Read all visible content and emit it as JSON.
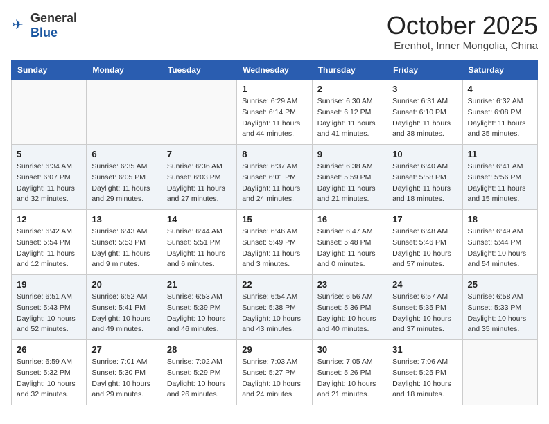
{
  "logo": {
    "general": "General",
    "blue": "Blue"
  },
  "header": {
    "month_title": "October 2025",
    "location": "Erenhot, Inner Mongolia, China"
  },
  "weekdays": [
    "Sunday",
    "Monday",
    "Tuesday",
    "Wednesday",
    "Thursday",
    "Friday",
    "Saturday"
  ],
  "weeks": [
    [
      {
        "day": "",
        "info": ""
      },
      {
        "day": "",
        "info": ""
      },
      {
        "day": "",
        "info": ""
      },
      {
        "day": "1",
        "info": "Sunrise: 6:29 AM\nSunset: 6:14 PM\nDaylight: 11 hours\nand 44 minutes."
      },
      {
        "day": "2",
        "info": "Sunrise: 6:30 AM\nSunset: 6:12 PM\nDaylight: 11 hours\nand 41 minutes."
      },
      {
        "day": "3",
        "info": "Sunrise: 6:31 AM\nSunset: 6:10 PM\nDaylight: 11 hours\nand 38 minutes."
      },
      {
        "day": "4",
        "info": "Sunrise: 6:32 AM\nSunset: 6:08 PM\nDaylight: 11 hours\nand 35 minutes."
      }
    ],
    [
      {
        "day": "5",
        "info": "Sunrise: 6:34 AM\nSunset: 6:07 PM\nDaylight: 11 hours\nand 32 minutes."
      },
      {
        "day": "6",
        "info": "Sunrise: 6:35 AM\nSunset: 6:05 PM\nDaylight: 11 hours\nand 29 minutes."
      },
      {
        "day": "7",
        "info": "Sunrise: 6:36 AM\nSunset: 6:03 PM\nDaylight: 11 hours\nand 27 minutes."
      },
      {
        "day": "8",
        "info": "Sunrise: 6:37 AM\nSunset: 6:01 PM\nDaylight: 11 hours\nand 24 minutes."
      },
      {
        "day": "9",
        "info": "Sunrise: 6:38 AM\nSunset: 5:59 PM\nDaylight: 11 hours\nand 21 minutes."
      },
      {
        "day": "10",
        "info": "Sunrise: 6:40 AM\nSunset: 5:58 PM\nDaylight: 11 hours\nand 18 minutes."
      },
      {
        "day": "11",
        "info": "Sunrise: 6:41 AM\nSunset: 5:56 PM\nDaylight: 11 hours\nand 15 minutes."
      }
    ],
    [
      {
        "day": "12",
        "info": "Sunrise: 6:42 AM\nSunset: 5:54 PM\nDaylight: 11 hours\nand 12 minutes."
      },
      {
        "day": "13",
        "info": "Sunrise: 6:43 AM\nSunset: 5:53 PM\nDaylight: 11 hours\nand 9 minutes."
      },
      {
        "day": "14",
        "info": "Sunrise: 6:44 AM\nSunset: 5:51 PM\nDaylight: 11 hours\nand 6 minutes."
      },
      {
        "day": "15",
        "info": "Sunrise: 6:46 AM\nSunset: 5:49 PM\nDaylight: 11 hours\nand 3 minutes."
      },
      {
        "day": "16",
        "info": "Sunrise: 6:47 AM\nSunset: 5:48 PM\nDaylight: 11 hours\nand 0 minutes."
      },
      {
        "day": "17",
        "info": "Sunrise: 6:48 AM\nSunset: 5:46 PM\nDaylight: 10 hours\nand 57 minutes."
      },
      {
        "day": "18",
        "info": "Sunrise: 6:49 AM\nSunset: 5:44 PM\nDaylight: 10 hours\nand 54 minutes."
      }
    ],
    [
      {
        "day": "19",
        "info": "Sunrise: 6:51 AM\nSunset: 5:43 PM\nDaylight: 10 hours\nand 52 minutes."
      },
      {
        "day": "20",
        "info": "Sunrise: 6:52 AM\nSunset: 5:41 PM\nDaylight: 10 hours\nand 49 minutes."
      },
      {
        "day": "21",
        "info": "Sunrise: 6:53 AM\nSunset: 5:39 PM\nDaylight: 10 hours\nand 46 minutes."
      },
      {
        "day": "22",
        "info": "Sunrise: 6:54 AM\nSunset: 5:38 PM\nDaylight: 10 hours\nand 43 minutes."
      },
      {
        "day": "23",
        "info": "Sunrise: 6:56 AM\nSunset: 5:36 PM\nDaylight: 10 hours\nand 40 minutes."
      },
      {
        "day": "24",
        "info": "Sunrise: 6:57 AM\nSunset: 5:35 PM\nDaylight: 10 hours\nand 37 minutes."
      },
      {
        "day": "25",
        "info": "Sunrise: 6:58 AM\nSunset: 5:33 PM\nDaylight: 10 hours\nand 35 minutes."
      }
    ],
    [
      {
        "day": "26",
        "info": "Sunrise: 6:59 AM\nSunset: 5:32 PM\nDaylight: 10 hours\nand 32 minutes."
      },
      {
        "day": "27",
        "info": "Sunrise: 7:01 AM\nSunset: 5:30 PM\nDaylight: 10 hours\nand 29 minutes."
      },
      {
        "day": "28",
        "info": "Sunrise: 7:02 AM\nSunset: 5:29 PM\nDaylight: 10 hours\nand 26 minutes."
      },
      {
        "day": "29",
        "info": "Sunrise: 7:03 AM\nSunset: 5:27 PM\nDaylight: 10 hours\nand 24 minutes."
      },
      {
        "day": "30",
        "info": "Sunrise: 7:05 AM\nSunset: 5:26 PM\nDaylight: 10 hours\nand 21 minutes."
      },
      {
        "day": "31",
        "info": "Sunrise: 7:06 AM\nSunset: 5:25 PM\nDaylight: 10 hours\nand 18 minutes."
      },
      {
        "day": "",
        "info": ""
      }
    ]
  ]
}
